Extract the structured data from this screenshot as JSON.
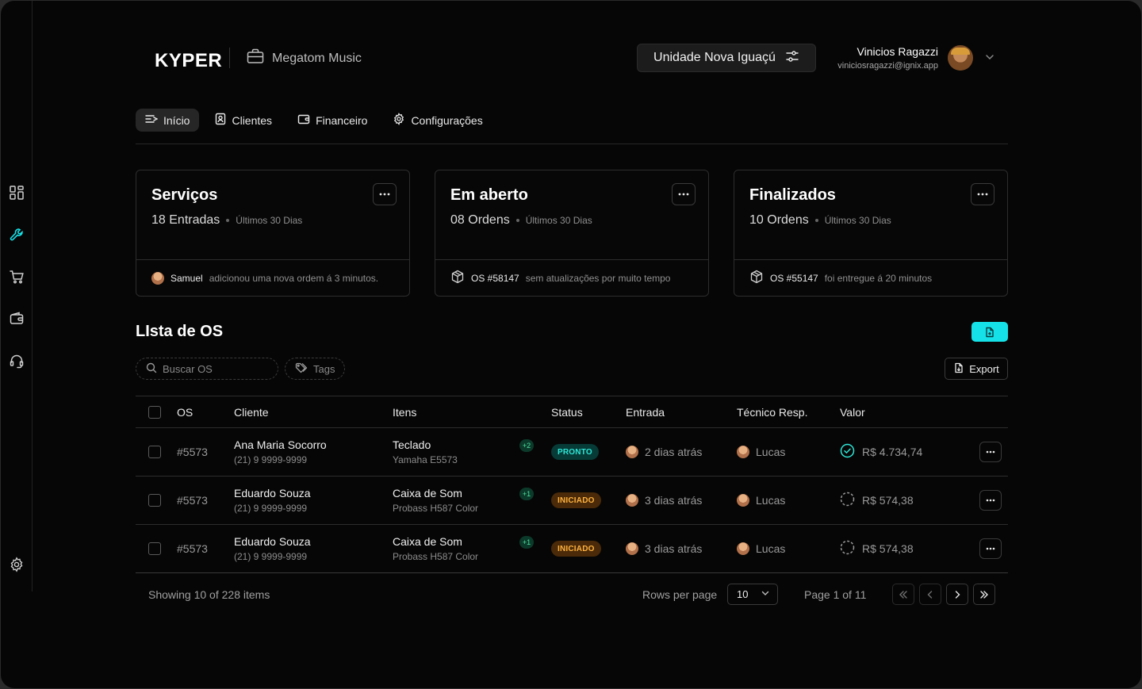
{
  "brand": {
    "logo": "KYPER",
    "org": "Megatom Music"
  },
  "unit": {
    "label": "Unidade Nova Iguaçú"
  },
  "user": {
    "name": "Vinicios Ragazzi",
    "email": "viniciosragazzi@ignix.app"
  },
  "nav": [
    {
      "label": "Início",
      "icon": "home-list-icon",
      "active": true
    },
    {
      "label": "Clientes",
      "icon": "contact-icon"
    },
    {
      "label": "Financeiro",
      "icon": "wallet-icon"
    },
    {
      "label": "Configurações",
      "icon": "gear-icon"
    }
  ],
  "sidebar": [
    "dashboard-icon",
    "wrench-icon",
    "cart-icon",
    "wallet-icon",
    "headset-icon",
    "gear-icon"
  ],
  "cards": [
    {
      "title": "Serviços",
      "count": "18 Entradas",
      "period": "Últimos 30 Dias",
      "foot_strong": "Samuel",
      "foot_rest": "adicionou uma nova ordem á 3 minutos."
    },
    {
      "title": "Em aberto",
      "count": "08 Ordens",
      "period": "Últimos 30 Dias",
      "foot_strong": "OS #58147",
      "foot_rest": "sem atualizações por muito tempo"
    },
    {
      "title": "Finalizados",
      "count": "10 Ordens",
      "period": "Últimos 30 Dias",
      "foot_strong": "OS #55147",
      "foot_rest": "foi entregue á 20 minutos"
    }
  ],
  "list": {
    "title": "LIsta de OS",
    "search_placeholder": "Buscar OS",
    "tags_label": "Tags",
    "export_label": "Export"
  },
  "table": {
    "headers": {
      "os": "OS",
      "client": "Cliente",
      "items": "Itens",
      "status": "Status",
      "entry": "Entrada",
      "tech": "Técnico Resp.",
      "value": "Valor"
    },
    "rows": [
      {
        "os": "#5573",
        "client": "Ana Maria Socorro",
        "phone": "(21) 9 9999-9999",
        "item": "Teclado",
        "item_model": "Yamaha E5573",
        "extra": "+2",
        "status": "PRONTO",
        "entry": "2 dias atrás",
        "tech": "Lucas",
        "value": "R$ 4.734,74"
      },
      {
        "os": "#5573",
        "client": "Eduardo Souza",
        "phone": "(21) 9 9999-9999",
        "item": "Caixa de Som",
        "item_model": "Probass H587 Color",
        "extra": "+1",
        "status": "INICIADO",
        "entry": "3 dias atrás",
        "tech": "Lucas",
        "value": "R$ 574,38"
      },
      {
        "os": "#5573",
        "client": "Eduardo Souza",
        "phone": "(21) 9 9999-9999",
        "item": "Caixa de Som",
        "item_model": "Probass H587 Color",
        "extra": "+1",
        "status": "INICIADO",
        "entry": "3 dias atrás",
        "tech": "Lucas",
        "value": "R$ 574,38"
      }
    ]
  },
  "footer": {
    "showing": "Showing 10 of 228 items",
    "rows_per_page_label": "Rows per page",
    "rows_per_page": "10",
    "page": "Page 1 of 11"
  },
  "colors": {
    "accent": "#15e2e8",
    "ready": "#2ee6d6",
    "started": "#ffb23f",
    "bg": "#060606"
  }
}
